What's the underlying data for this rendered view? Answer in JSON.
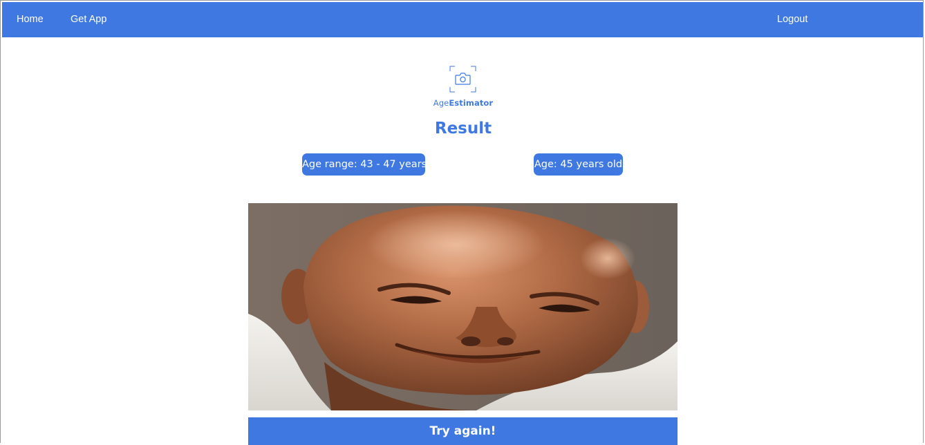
{
  "nav": {
    "home_label": "Home",
    "get_app_label": "Get App",
    "logout_label": "Logout"
  },
  "logo": {
    "icon": "camera-icon",
    "name_light": "Age",
    "name_bold": "Estimator"
  },
  "result": {
    "title": "Result",
    "age_range_label": "Age range: 43 - 47 years",
    "age_label": "Age: 45 years old"
  },
  "photo": {
    "subject": "uploaded-face-photo"
  },
  "actions": {
    "try_again_label": "Try again!"
  },
  "colors": {
    "accent": "#3e78e0",
    "background": "#ffffff",
    "text_on_accent": "#ffffff"
  }
}
